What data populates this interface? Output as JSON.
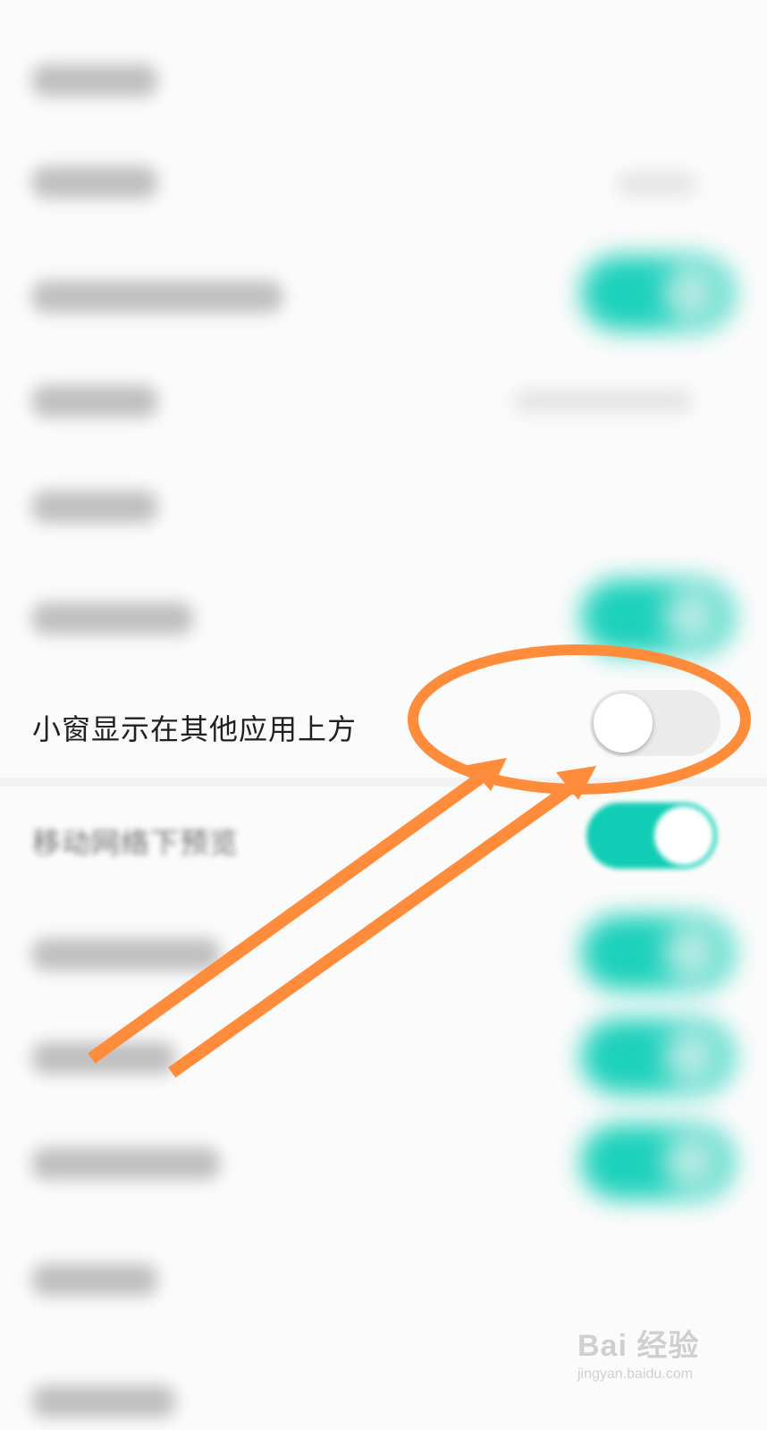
{
  "settings": {
    "floating_window_row": {
      "label": "小窗显示在其他应用上方",
      "enabled": false
    },
    "mobile_preview_row": {
      "label": "移动网络下预览",
      "enabled": true
    }
  },
  "colors": {
    "accent_toggle_on": "#11cdb5",
    "annotation_orange": "#ff8c3a"
  },
  "watermark": {
    "brand": "Bai 经验",
    "site": "jingyan.baidu.com"
  }
}
